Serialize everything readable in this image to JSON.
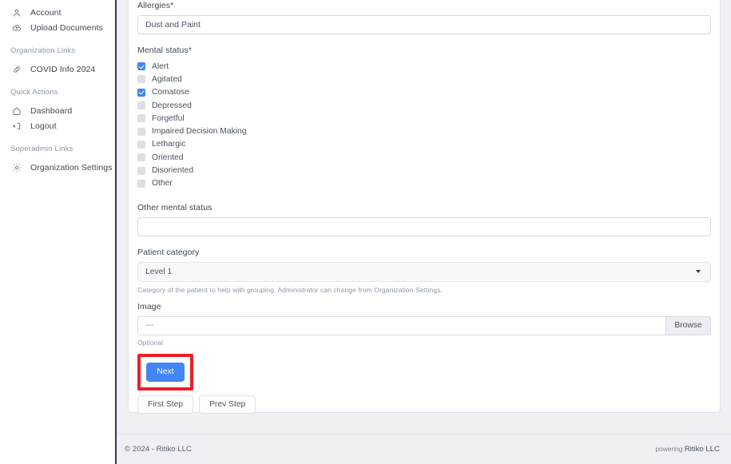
{
  "sidebar": {
    "top_items": [
      {
        "label": "Account",
        "icon": "user-icon"
      },
      {
        "label": "Upload Documents",
        "icon": "cloud-upload-icon"
      }
    ],
    "sections": [
      {
        "title": "Organization Links",
        "items": [
          {
            "label": "COVID Info 2024",
            "icon": "link-icon"
          }
        ]
      },
      {
        "title": "Quick Actions",
        "items": [
          {
            "label": "Dashboard",
            "icon": "home-icon"
          },
          {
            "label": "Logout",
            "icon": "logout-icon"
          }
        ]
      },
      {
        "title": "Superadmin Links",
        "items": [
          {
            "label": "Organization Settings",
            "icon": "gear-icon"
          }
        ]
      }
    ]
  },
  "form": {
    "allergies": {
      "label": "Allergies*",
      "value": "Dust and Paint",
      "placeholder": ""
    },
    "mental_status": {
      "label": "Mental status*",
      "options": [
        {
          "label": "Alert",
          "checked": true
        },
        {
          "label": "Agitated",
          "checked": false
        },
        {
          "label": "Comatose",
          "checked": true
        },
        {
          "label": "Depressed",
          "checked": false
        },
        {
          "label": "Forgetful",
          "checked": false
        },
        {
          "label": "Impaired Decision Making",
          "checked": false
        },
        {
          "label": "Lethargic",
          "checked": false
        },
        {
          "label": "Oriented",
          "checked": false
        },
        {
          "label": "Disoriented",
          "checked": false
        },
        {
          "label": "Other",
          "checked": false
        }
      ]
    },
    "other_mental_status": {
      "label": "Other mental status",
      "value": "",
      "placeholder": ""
    },
    "patient_category": {
      "label": "Patient category",
      "value": "Level 1",
      "help": "Category of the patient to help with grouping. Administrator can change from Organization Settings."
    },
    "image": {
      "label": "Image",
      "value": "---",
      "browse_label": "Browse",
      "help": "Optional"
    },
    "buttons": {
      "next": "Next",
      "first_step": "First Step",
      "prev_step": "Prev Step"
    }
  },
  "annotation": {
    "color": "#e8202a",
    "target": "next-button"
  },
  "footer": {
    "copyright": "© 2024 - Ritiko LLC",
    "powering_prefix": "powering ",
    "powering_brand": "Ritiko LLC"
  },
  "colors": {
    "accent": "#4285f4",
    "sidebar_border": "#2b3a55",
    "page_bg": "#eef0f3"
  }
}
